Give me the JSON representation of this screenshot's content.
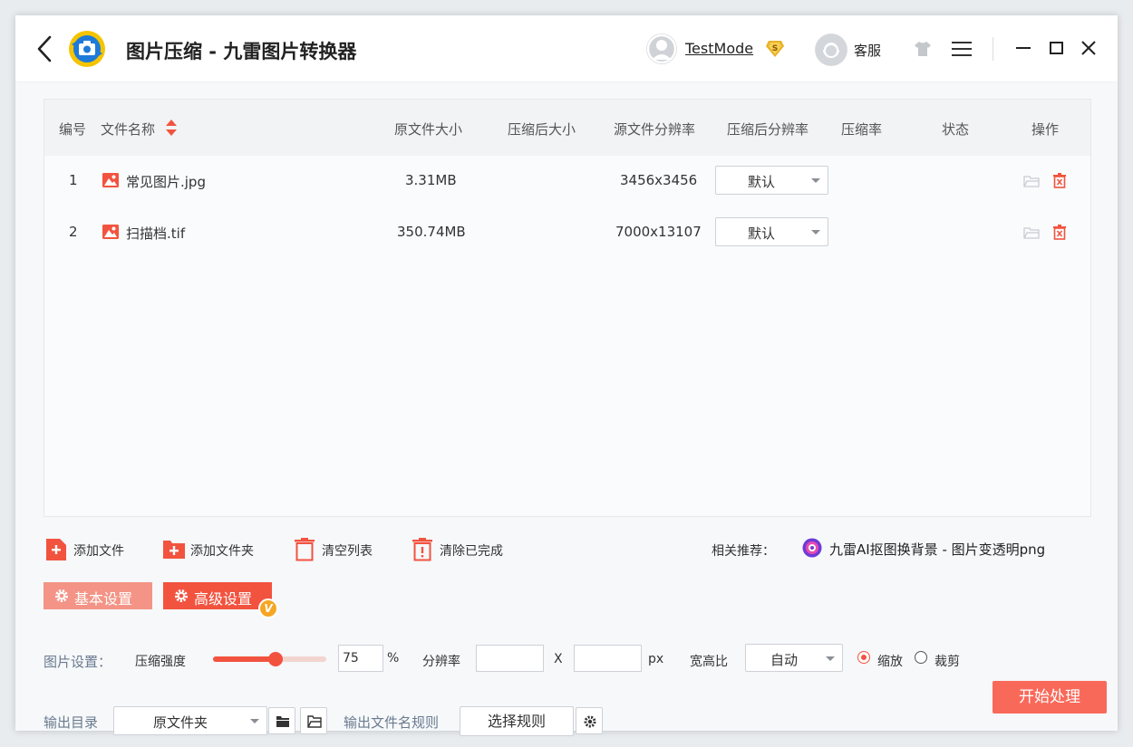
{
  "titlebar": {
    "app_title": "图片压缩 - 九雷图片转换器",
    "username": "TestMode",
    "support_label": "客服"
  },
  "table": {
    "headers": {
      "index": "编号",
      "filename": "文件名称",
      "original_size": "原文件大小",
      "compressed_size": "压缩后大小",
      "source_resolution": "源文件分辨率",
      "compressed_resolution": "压缩后分辨率",
      "ratio": "压缩率",
      "status": "状态",
      "actions": "操作"
    },
    "rows": [
      {
        "index": "1",
        "filename": "常见图片.jpg",
        "original_size": "3.31MB",
        "source_resolution": "3456x3456",
        "resolution_option": "默认"
      },
      {
        "index": "2",
        "filename": "扫描档.tif",
        "original_size": "350.74MB",
        "source_resolution": "7000x13107",
        "resolution_option": "默认"
      }
    ]
  },
  "toolbar": {
    "add_file": "添加文件",
    "add_folder": "添加文件夹",
    "clear_list": "清空列表",
    "clear_done": "清除已完成",
    "recommend_label": "相关推荐：",
    "recommend_link": "九雷AI抠图换背景 - 图片变透明png"
  },
  "tabs": {
    "basic": "基本设置",
    "advanced": "高级设置",
    "vip_badge": "V"
  },
  "settings": {
    "section_label": "图片设置：",
    "strength_label": "压缩强度",
    "strength_value": "75",
    "strength_fraction": 0.55,
    "percent_unit": "%",
    "resolution_label": "分辨率",
    "times": "X",
    "px_unit": "px",
    "aspect_label": "宽高比",
    "aspect_value": "自动",
    "scale_label": "缩放",
    "crop_label": "裁剪"
  },
  "output": {
    "dir_label": "输出目录",
    "dir_value": "原文件夹",
    "rule_label": "输出文件名规则",
    "rule_button": "选择规则",
    "start_button": "开始处理"
  },
  "colors": {
    "accent": "#f2533f",
    "accent_light": "#f49486",
    "start": "#f9695a",
    "vip": "#f5a623"
  }
}
